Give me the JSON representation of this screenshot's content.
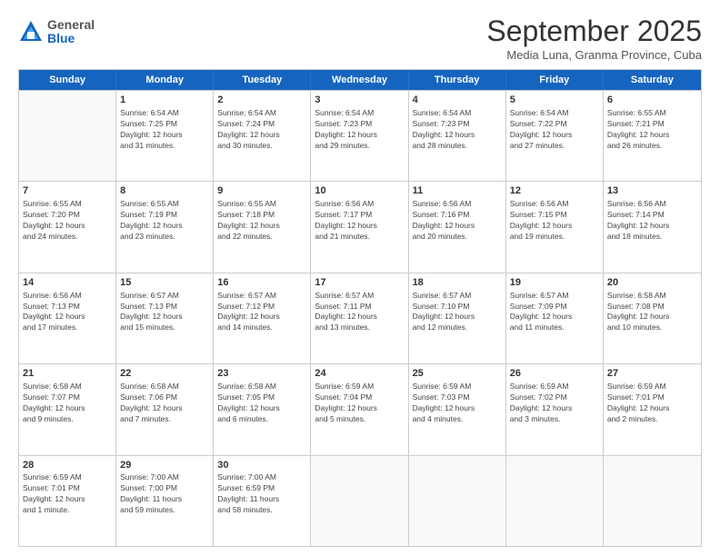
{
  "logo": {
    "general": "General",
    "blue": "Blue"
  },
  "title": "September 2025",
  "subtitle": "Media Luna, Granma Province, Cuba",
  "header_days": [
    "Sunday",
    "Monday",
    "Tuesday",
    "Wednesday",
    "Thursday",
    "Friday",
    "Saturday"
  ],
  "weeks": [
    [
      {
        "day": "",
        "info": ""
      },
      {
        "day": "1",
        "info": "Sunrise: 6:54 AM\nSunset: 7:25 PM\nDaylight: 12 hours\nand 31 minutes."
      },
      {
        "day": "2",
        "info": "Sunrise: 6:54 AM\nSunset: 7:24 PM\nDaylight: 12 hours\nand 30 minutes."
      },
      {
        "day": "3",
        "info": "Sunrise: 6:54 AM\nSunset: 7:23 PM\nDaylight: 12 hours\nand 29 minutes."
      },
      {
        "day": "4",
        "info": "Sunrise: 6:54 AM\nSunset: 7:23 PM\nDaylight: 12 hours\nand 28 minutes."
      },
      {
        "day": "5",
        "info": "Sunrise: 6:54 AM\nSunset: 7:22 PM\nDaylight: 12 hours\nand 27 minutes."
      },
      {
        "day": "6",
        "info": "Sunrise: 6:55 AM\nSunset: 7:21 PM\nDaylight: 12 hours\nand 26 minutes."
      }
    ],
    [
      {
        "day": "7",
        "info": "Sunrise: 6:55 AM\nSunset: 7:20 PM\nDaylight: 12 hours\nand 24 minutes."
      },
      {
        "day": "8",
        "info": "Sunrise: 6:55 AM\nSunset: 7:19 PM\nDaylight: 12 hours\nand 23 minutes."
      },
      {
        "day": "9",
        "info": "Sunrise: 6:55 AM\nSunset: 7:18 PM\nDaylight: 12 hours\nand 22 minutes."
      },
      {
        "day": "10",
        "info": "Sunrise: 6:56 AM\nSunset: 7:17 PM\nDaylight: 12 hours\nand 21 minutes."
      },
      {
        "day": "11",
        "info": "Sunrise: 6:56 AM\nSunset: 7:16 PM\nDaylight: 12 hours\nand 20 minutes."
      },
      {
        "day": "12",
        "info": "Sunrise: 6:56 AM\nSunset: 7:15 PM\nDaylight: 12 hours\nand 19 minutes."
      },
      {
        "day": "13",
        "info": "Sunrise: 6:56 AM\nSunset: 7:14 PM\nDaylight: 12 hours\nand 18 minutes."
      }
    ],
    [
      {
        "day": "14",
        "info": "Sunrise: 6:56 AM\nSunset: 7:13 PM\nDaylight: 12 hours\nand 17 minutes."
      },
      {
        "day": "15",
        "info": "Sunrise: 6:57 AM\nSunset: 7:13 PM\nDaylight: 12 hours\nand 15 minutes."
      },
      {
        "day": "16",
        "info": "Sunrise: 6:57 AM\nSunset: 7:12 PM\nDaylight: 12 hours\nand 14 minutes."
      },
      {
        "day": "17",
        "info": "Sunrise: 6:57 AM\nSunset: 7:11 PM\nDaylight: 12 hours\nand 13 minutes."
      },
      {
        "day": "18",
        "info": "Sunrise: 6:57 AM\nSunset: 7:10 PM\nDaylight: 12 hours\nand 12 minutes."
      },
      {
        "day": "19",
        "info": "Sunrise: 6:57 AM\nSunset: 7:09 PM\nDaylight: 12 hours\nand 11 minutes."
      },
      {
        "day": "20",
        "info": "Sunrise: 6:58 AM\nSunset: 7:08 PM\nDaylight: 12 hours\nand 10 minutes."
      }
    ],
    [
      {
        "day": "21",
        "info": "Sunrise: 6:58 AM\nSunset: 7:07 PM\nDaylight: 12 hours\nand 9 minutes."
      },
      {
        "day": "22",
        "info": "Sunrise: 6:58 AM\nSunset: 7:06 PM\nDaylight: 12 hours\nand 7 minutes."
      },
      {
        "day": "23",
        "info": "Sunrise: 6:58 AM\nSunset: 7:05 PM\nDaylight: 12 hours\nand 6 minutes."
      },
      {
        "day": "24",
        "info": "Sunrise: 6:59 AM\nSunset: 7:04 PM\nDaylight: 12 hours\nand 5 minutes."
      },
      {
        "day": "25",
        "info": "Sunrise: 6:59 AM\nSunset: 7:03 PM\nDaylight: 12 hours\nand 4 minutes."
      },
      {
        "day": "26",
        "info": "Sunrise: 6:59 AM\nSunset: 7:02 PM\nDaylight: 12 hours\nand 3 minutes."
      },
      {
        "day": "27",
        "info": "Sunrise: 6:59 AM\nSunset: 7:01 PM\nDaylight: 12 hours\nand 2 minutes."
      }
    ],
    [
      {
        "day": "28",
        "info": "Sunrise: 6:59 AM\nSunset: 7:01 PM\nDaylight: 12 hours\nand 1 minute."
      },
      {
        "day": "29",
        "info": "Sunrise: 7:00 AM\nSunset: 7:00 PM\nDaylight: 11 hours\nand 59 minutes."
      },
      {
        "day": "30",
        "info": "Sunrise: 7:00 AM\nSunset: 6:59 PM\nDaylight: 11 hours\nand 58 minutes."
      },
      {
        "day": "",
        "info": ""
      },
      {
        "day": "",
        "info": ""
      },
      {
        "day": "",
        "info": ""
      },
      {
        "day": "",
        "info": ""
      }
    ]
  ]
}
